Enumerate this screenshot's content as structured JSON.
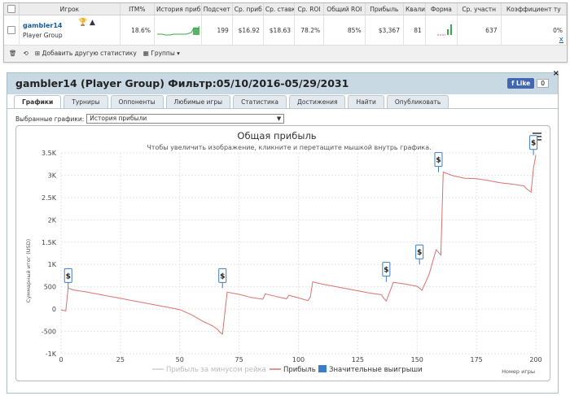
{
  "stats_table": {
    "headers": [
      "Игрок",
      "ITM%",
      "История приб",
      "Подсчет",
      "Ср. приб",
      "Ср. ставк",
      "Ср. ROI",
      "Общий ROI",
      "Прибыль",
      "Квали",
      "Форма",
      "Ср. участн",
      "Коэффициент ту"
    ],
    "player": {
      "name": "gambler14",
      "group": "Player Group"
    },
    "values": {
      "itm": "18.6%",
      "count": "199",
      "avg_profit": "$16.92",
      "avg_stake": "$18.63",
      "avg_roi": "78.2%",
      "total_roi": "85%",
      "profit": "$3,367",
      "quali": "81",
      "avg_entrants": "637",
      "coef": "0%"
    },
    "remove_link": "x"
  },
  "toolbar": {
    "add_label": "Добавить другую статистику",
    "groups_label": "Группы"
  },
  "panel": {
    "title": "gambler14 (Player Group) Фильтр:05/10/2016-05/29/2031",
    "fb_like": "Like",
    "fb_count": "0",
    "close": "×",
    "tabs": [
      "Графики",
      "Турниры",
      "Оппоненты",
      "Любимые игры",
      "Статистика",
      "Достижения",
      "Найти",
      "Опубликовать"
    ],
    "select_label": "Выбранные графики:",
    "select_value": "История прибыли"
  },
  "chart_data": {
    "type": "line",
    "title": "Общая прибыль",
    "subtitle": "Чтобы увеличить изображение, кликните и перетащите мышкой внутрь графика.",
    "ylabel": "Суммарный итог (USD)",
    "xlabel": "Номер игры",
    "xlim": [
      0,
      200
    ],
    "ylim": [
      -1000,
      3500
    ],
    "x_ticks": [
      "0",
      "25",
      "50",
      "75",
      "100",
      "125",
      "150",
      "175",
      "200"
    ],
    "y_ticks": [
      "-1K",
      "-500",
      "0",
      "500",
      "1K",
      "1.5K",
      "2K",
      "2.5K",
      "3K",
      "3.5K"
    ],
    "legend": [
      "Прибыль за минусом рейка",
      "Прибыль",
      "Значительные выигрыши"
    ],
    "colors": {
      "profit": "#d9736f",
      "rake": "#d0d0d0",
      "big_win": "#3a7ec7"
    },
    "series": [
      {
        "name": "Прибыль",
        "x": [
          0,
          1,
          2,
          3,
          5,
          10,
          15,
          20,
          25,
          30,
          35,
          40,
          45,
          50,
          55,
          60,
          64,
          66,
          67,
          68,
          70,
          75,
          80,
          85,
          86,
          90,
          95,
          96,
          100,
          104,
          105,
          106,
          110,
          115,
          120,
          125,
          130,
          135,
          136,
          137,
          140,
          145,
          150,
          151,
          152,
          155,
          158,
          159,
          160,
          161,
          165,
          170,
          175,
          180,
          185,
          190,
          195,
          196,
          197,
          198,
          199,
          200
        ],
        "y": [
          -20,
          -30,
          -40,
          470,
          430,
          390,
          340,
          290,
          240,
          190,
          140,
          90,
          40,
          -10,
          -130,
          -280,
          -380,
          -460,
          -520,
          -560,
          380,
          330,
          260,
          220,
          340,
          290,
          230,
          310,
          250,
          190,
          270,
          610,
          560,
          510,
          460,
          410,
          360,
          320,
          240,
          180,
          600,
          560,
          510,
          470,
          420,
          770,
          1330,
          1270,
          1210,
          3070,
          2990,
          2930,
          2920,
          2880,
          2830,
          2800,
          2760,
          2700,
          2660,
          2620,
          3150,
          3450
        ]
      },
      {
        "name": "Значительные выигрыши",
        "x": [
          3,
          68,
          137,
          151,
          159,
          199
        ],
        "y": [
          470,
          470,
          610,
          1000,
          3070,
          3450
        ]
      }
    ]
  }
}
